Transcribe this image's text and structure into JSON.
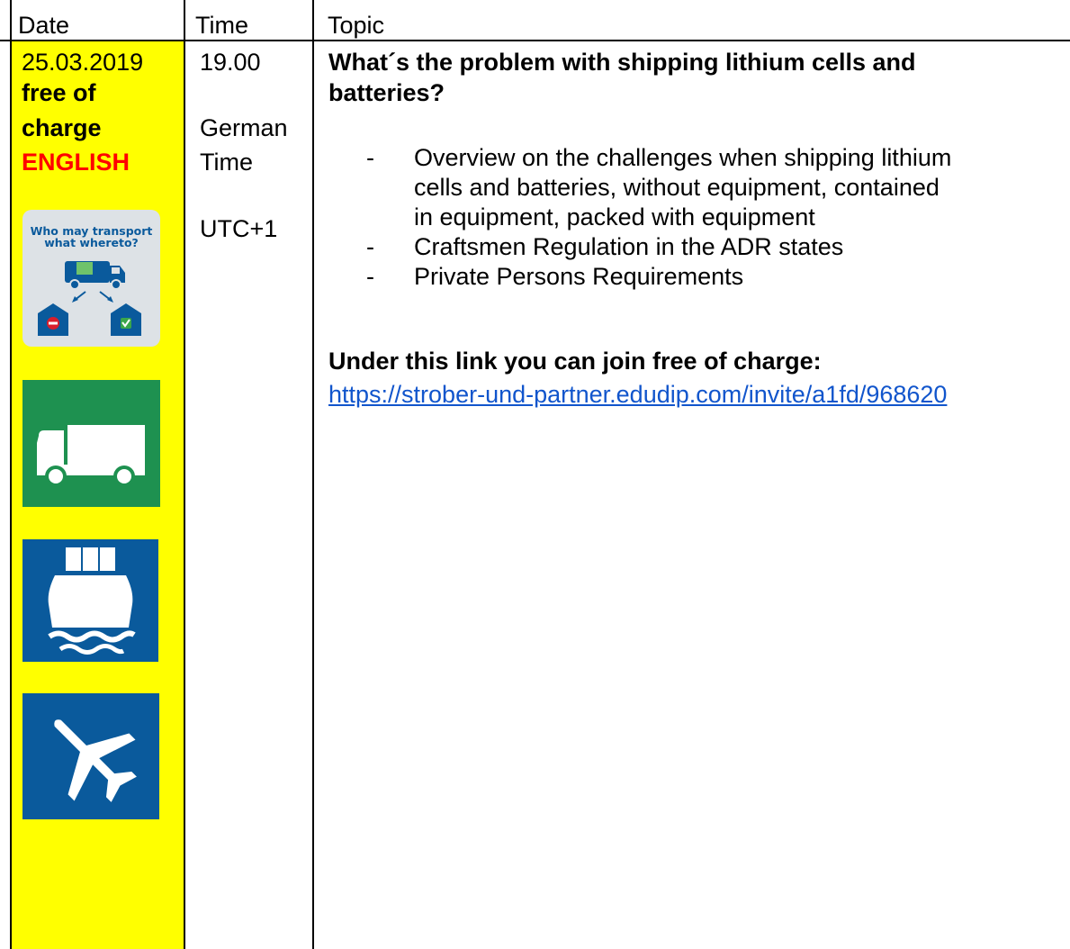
{
  "header": {
    "date": "Date",
    "time": "Time",
    "topic": "Topic"
  },
  "date_cell": {
    "date": "25.03.2019",
    "free_line1": "free of",
    "free_line2": "charge",
    "language": "ENGLISH",
    "badge_line1": "Who may transport",
    "badge_line2": "what whereto?"
  },
  "time_cell": {
    "time": "19.00",
    "zone_line1": "German",
    "zone_line2": "Time",
    "utc": "UTC+1"
  },
  "topic_cell": {
    "title_line1": "What´s the problem with shipping lithium cells and",
    "title_line2": "batteries?",
    "bullet_dash": "-",
    "bullets": [
      {
        "line1": "Overview on the challenges when shipping lithium",
        "line2": "cells and batteries, without equipment, contained",
        "line3": "in equipment, packed with equipment"
      },
      {
        "line1": "Craftsmen Regulation in the ADR states"
      },
      {
        "line1": "Private Persons Requirements"
      }
    ],
    "link_heading": "Under this link you can join free of charge:",
    "link_url": "https://strober-und-partner.edudip.com/invite/a1fd/968620"
  },
  "colors": {
    "highlight": "#ffff00",
    "language_red": "#ff0000",
    "road_green": "#1e9150",
    "sea_blue": "#0a5a9c",
    "air_blue": "#0a5a9c",
    "link_blue": "#1155cc"
  },
  "icons": [
    "who-may-transport-icon",
    "truck-icon",
    "ship-icon",
    "airplane-icon"
  ]
}
